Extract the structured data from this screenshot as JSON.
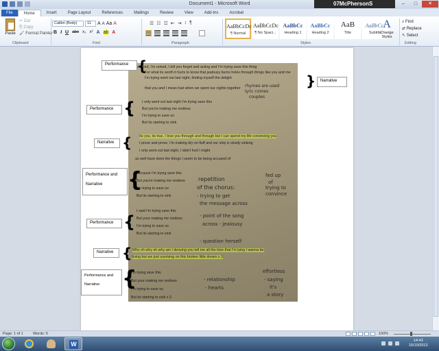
{
  "window": {
    "title": "Document1 - Microsoft Word",
    "user": "07McPhersonS"
  },
  "tabs": [
    "File",
    "Home",
    "Insert",
    "Page Layout",
    "References",
    "Mailings",
    "Review",
    "View",
    "Add-Ins",
    "Acrobat"
  ],
  "active_tab": "Home",
  "clipboard": {
    "paste": "Paste",
    "cut": "Cut",
    "copy": "Copy",
    "format_painter": "Format Painter",
    "group": "Clipboard"
  },
  "font": {
    "name": "Calibri (Body)",
    "size": "11",
    "group": "Font",
    "bold": "B",
    "italic": "I",
    "underline": "U",
    "strike": "abe",
    "sub": "x₂",
    "sup": "x²"
  },
  "paragraph": {
    "group": "Paragraph"
  },
  "styles": {
    "group": "Styles",
    "items": [
      {
        "preview": "AaBbCcDc",
        "name": "¶ Normal"
      },
      {
        "preview": "AaBbCcDc",
        "name": "¶ No Spaci..."
      },
      {
        "preview": "AaBbCc",
        "name": "Heading 1"
      },
      {
        "preview": "AaBbCc",
        "name": "Heading 2"
      },
      {
        "preview": "AaB",
        "name": "Title"
      },
      {
        "preview": "AaBbCc.",
        "name": "Subtitle"
      }
    ],
    "change": "Change Styles"
  },
  "editing": {
    "group": "Editing",
    "find": "Find",
    "replace": "Replace",
    "select": "Select"
  },
  "labels": {
    "performance_1": "Performance",
    "narrative_1": "Narrative",
    "performance_2": "Performance",
    "narrative_2": "Narrative",
    "perf_narr_1a": "Performance and",
    "perf_narr_1b": "Narrative",
    "performance_3": "Performance",
    "narrative_3": "Narrative",
    "perf_narr_2a": "Performance and",
    "perf_narr_2b": "Narrative"
  },
  "lyrics": [
    "Amazed, I'm ruined, I tell you forget and acting and I'm trying save this thing",
    "For what its worth it hurts to know that jealousy burns holes through things like you and me",
    "I'm trying went out last night, finding myself the delight",
    "that you and I mean had when we spent our nights together",
    "I only went out last night I'm trying save this",
    "But you're making me restless",
    "I'm trying to save us",
    "But its starting to sink",
    "Its you, its true, I love you through and through but I can spend my life convincing you",
    "I prove and prove, I'm making dry on fluff and our ship is slowly sinking",
    "I only went out last night, I didn't hurt I might",
    "as well have done the things I seem to be being accused of",
    "Because I'm trying save this",
    "But you're making me restless",
    "I'm trying to save us",
    "But its starting to sink",
    "I said I'm trying save this",
    "But your making me restless",
    "I'm trying to save us",
    "But its starting to sink",
    "Why oh why oh why am I denying you tell me all the time that I'm lying I wanna be",
    "living but we just surviving on this broken little dream x 3",
    "I'm trying save this",
    "But your making me restless",
    "I'm trying to save us",
    "But its starting to sink x 3"
  ],
  "notes": {
    "n1": "repetition",
    "n2": "of the chorus:",
    "n3": "- trying to get",
    "n4": "the message across",
    "n5": "- point of the song",
    "n6": "across - jealousy",
    "n7": "- question herself",
    "n8": "- relationship",
    "n9": "- hearts",
    "n10": "effortless",
    "n11": "- saying",
    "n12": "it's",
    "n13": "a story",
    "n14": "fed up",
    "n15": "of",
    "n16": "trying to",
    "n17": "convince",
    "n18": "rhymes are used",
    "n19": "lyric comes",
    "n20": "couples"
  },
  "status": {
    "page": "Page: 1 of 1",
    "words": "Words: 5",
    "zoom": "100%"
  },
  "clock": {
    "time": "14:43",
    "date": "15/10/2013"
  },
  "colors": {
    "file_tab": "#2a63b8",
    "highlight": "#d5e839",
    "taskbar": "#2f4f73"
  }
}
